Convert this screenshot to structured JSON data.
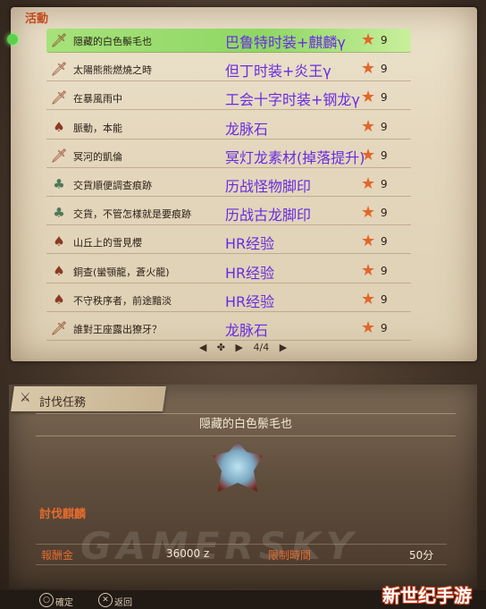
{
  "section": {
    "label": "活動"
  },
  "quests": [
    {
      "name": "隠藏的白色鬃毛也",
      "reward": "巴鲁特时装+麒麟γ",
      "rank": "9",
      "icon": "sword-icon",
      "selected": true
    },
    {
      "name": "太陽熊熊燃燒之時",
      "reward": "但丁时装+炎王γ",
      "rank": "9",
      "icon": "sword-icon"
    },
    {
      "name": "在暴風雨中",
      "reward": "工会十字时装+钢龙γ",
      "rank": "9",
      "icon": "sword-icon"
    },
    {
      "name": "脈動，本能",
      "reward": "龙脉石",
      "rank": "9",
      "icon": "monster-icon"
    },
    {
      "name": "冥河的凱倫",
      "reward": "冥灯龙素材(掉落提升)",
      "rank": "9",
      "icon": "sword-icon"
    },
    {
      "name": "交貨順便調查痕跡",
      "reward": "历战怪物脚印",
      "rank": "9",
      "icon": "item-icon"
    },
    {
      "name": "交貨，不管怎樣就是要痕跡",
      "reward": "历战古龙脚印",
      "rank": "9",
      "icon": "item-icon"
    },
    {
      "name": "山丘上的雪見櫻",
      "reward": "HR经验",
      "rank": "9",
      "icon": "monster-icon"
    },
    {
      "name": "銅查(蠻顎龍，蒼火龍)",
      "reward": "HR经验",
      "rank": "9",
      "icon": "monster-icon"
    },
    {
      "name": "不守秩序者，前途黯淡",
      "reward": "HR经验",
      "rank": "9",
      "icon": "monster-icon"
    },
    {
      "name": "誰對王座露出獠牙？",
      "reward": "龙脉石",
      "rank": "9",
      "icon": "sword-icon"
    }
  ],
  "pager": {
    "text": "4/4"
  },
  "detail": {
    "tab_label": "討伐任務",
    "quest_title": "隠藏的白色鬃毛也",
    "target_label": "討伐麒麟",
    "reward_label": "報酬金",
    "reward_value": "36000 z",
    "time_label": "限制時間",
    "time_value": "50分"
  },
  "watermark": "GAMERSKY",
  "footer": {
    "confirm": "確定",
    "back": "返回"
  },
  "site_logo": "新世纪手游",
  "colors": {
    "reward_text": "#6a2be0",
    "accent": "#e36b2e",
    "selected_row": "#8ed764"
  }
}
